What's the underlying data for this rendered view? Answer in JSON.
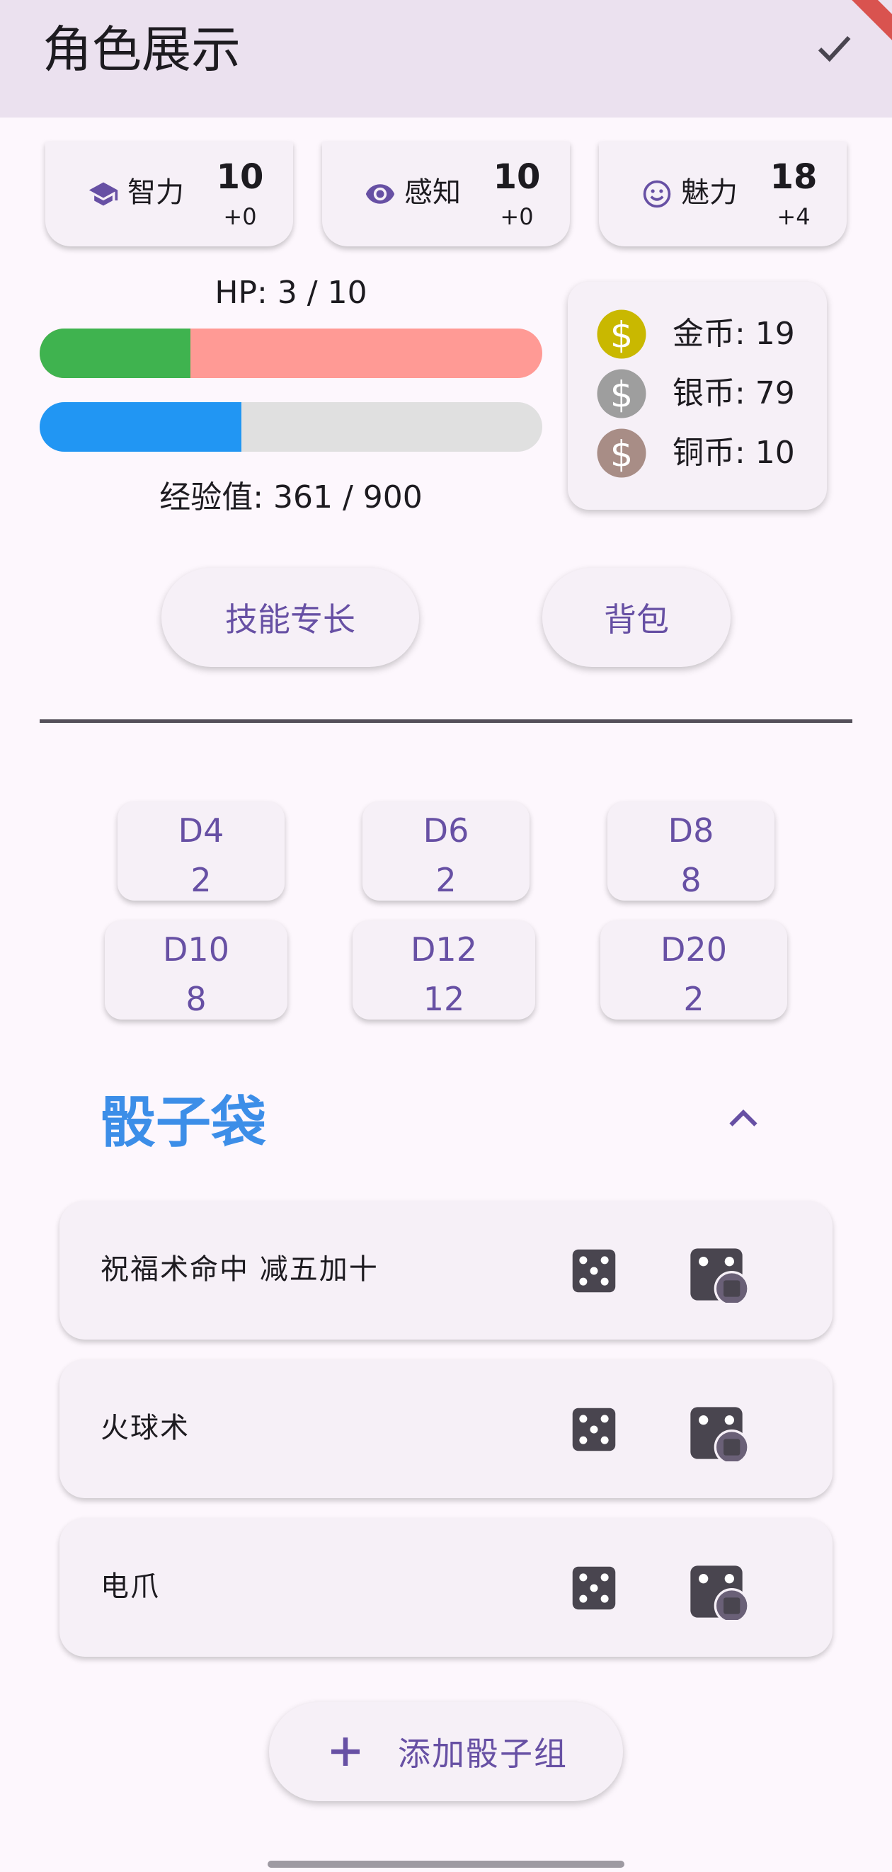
{
  "appbar": {
    "title": "角色展示",
    "confirm_icon": "check-icon"
  },
  "stats": [
    {
      "icon": "graduation-cap-icon",
      "name": "智力",
      "value": "10",
      "mod": "+0"
    },
    {
      "icon": "eye-icon",
      "name": "感知",
      "value": "10",
      "mod": "+0"
    },
    {
      "icon": "smiley-icon",
      "name": "魅力",
      "value": "18",
      "mod": "+4"
    }
  ],
  "hp": {
    "label": "HP: 3 / 10",
    "fraction": 0.3,
    "fill_color": "#3fb34f",
    "empty_color": "#ff9a95"
  },
  "exp": {
    "label": "经验值: 361 / 900",
    "fraction": 0.401,
    "fill_color": "#2196f3",
    "empty_color": "#e0e0e0"
  },
  "coins": [
    {
      "icon": "dollar-coin-icon",
      "label": "金币: 19",
      "color": "#c9b800"
    },
    {
      "icon": "dollar-coin-icon",
      "label": "银币: 79",
      "color": "#9e9e9e"
    },
    {
      "icon": "dollar-coin-icon",
      "label": "铜币: 10",
      "color": "#a88d86"
    }
  ],
  "buttons": {
    "skills": "技能专长",
    "backpack": "背包"
  },
  "dice": [
    {
      "name": "D4",
      "count": "2"
    },
    {
      "name": "D6",
      "count": "2"
    },
    {
      "name": "D8",
      "count": "8"
    },
    {
      "name": "D10",
      "count": "8"
    },
    {
      "name": "D12",
      "count": "12"
    },
    {
      "name": "D20",
      "count": "2"
    }
  ],
  "dice_bag": {
    "title": "骰子袋",
    "toggle_icon": "chevron-up-icon",
    "groups": [
      {
        "name": "祝福术命中 减五加十"
      },
      {
        "name": "火球术"
      },
      {
        "name": "电爪"
      }
    ],
    "add_label": "添加骰子组"
  },
  "colors": {
    "accent": "#6750a4",
    "section_title": "#3c8ee8"
  }
}
